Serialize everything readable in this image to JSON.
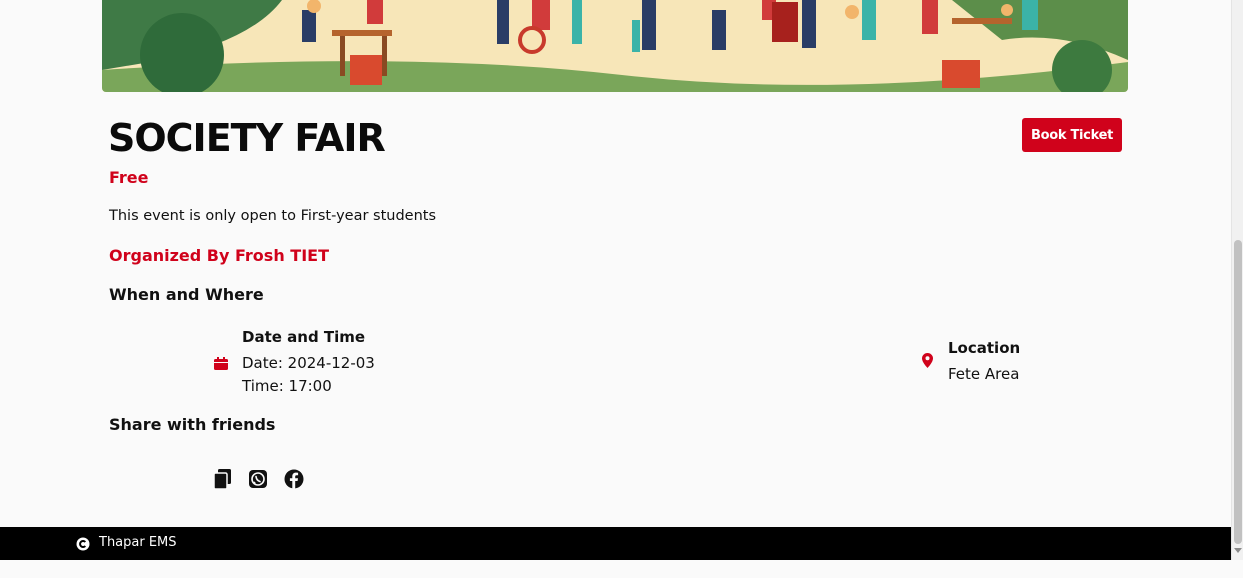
{
  "event": {
    "title": "SOCIETY FAIR",
    "price": "Free",
    "description": "This event is only open to First-year students",
    "organizer": "Organized By Frosh TIET"
  },
  "actions": {
    "book_label": "Book Ticket"
  },
  "when_where": {
    "heading": "When and Where",
    "date_time_heading": "Date and Time",
    "date": "Date: 2024-12-03",
    "time": "Time: 17:00",
    "location_heading": "Location",
    "location": "Fete Area"
  },
  "share": {
    "heading": "Share with friends",
    "icons": [
      "copy-icon",
      "whatsapp-icon",
      "facebook-icon"
    ]
  },
  "footer": {
    "brand": "Thapar EMS",
    "icon": "copyright-icon"
  },
  "colors": {
    "accent": "#d0021b",
    "footer_bg": "#000000",
    "page_bg": "#fafafa"
  }
}
